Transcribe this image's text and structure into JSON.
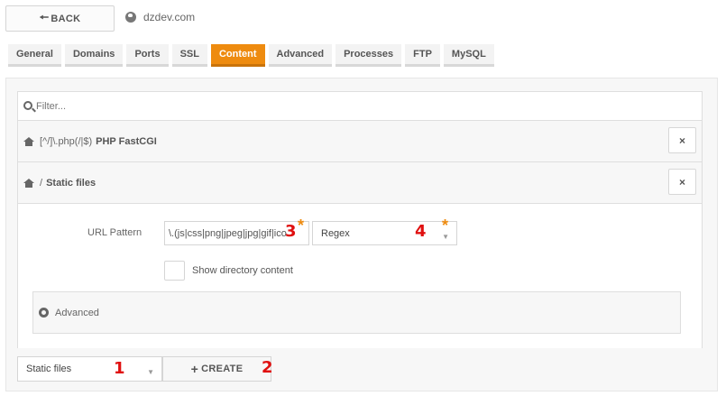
{
  "topbar": {
    "back_label": "BACK",
    "back_icon": "arrow-left-icon",
    "site_name": "dzdev.com",
    "site_icon": "globe-icon"
  },
  "tabs": [
    {
      "label": "General",
      "active": false
    },
    {
      "label": "Domains",
      "active": false
    },
    {
      "label": "Ports",
      "active": false
    },
    {
      "label": "SSL",
      "active": false
    },
    {
      "label": "Content",
      "active": true
    },
    {
      "label": "Advanced",
      "active": false
    },
    {
      "label": "Processes",
      "active": false
    },
    {
      "label": "FTP",
      "active": false
    },
    {
      "label": "MySQL",
      "active": false
    }
  ],
  "filter": {
    "placeholder": "Filter...",
    "icon": "search-icon"
  },
  "rules": [
    {
      "path": "[^/]\\.php(/|$)",
      "name": "PHP FastCGI",
      "close_label": "×"
    },
    {
      "path": "/",
      "name": "Static files",
      "close_label": "×"
    }
  ],
  "detail": {
    "url_pattern_label": "URL Pattern",
    "url_pattern_value": "\\.(js|css|png|jpeg|jpg|gif|ico",
    "match_type": "Regex",
    "required_star": "*",
    "show_dir_label": "Show directory content",
    "show_dir_checked": false,
    "advanced_label": "Advanced"
  },
  "bottom": {
    "type_value": "Static files",
    "create_label": "CREATE",
    "create_icon": "plus-icon"
  },
  "annotations": [
    "1",
    "2",
    "3",
    "4"
  ],
  "colors": {
    "accent": "#ee8b0f",
    "annotation": "#e01010"
  }
}
